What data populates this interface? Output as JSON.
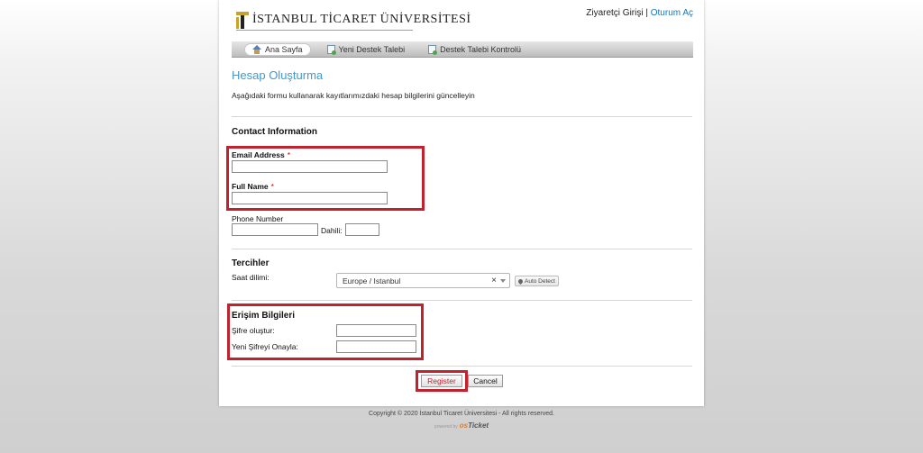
{
  "header": {
    "logo_text": "İSTANBUL TİCARET ÜNİVERSİTESİ",
    "guest_login": "Ziyaretçi Girişi",
    "separator": "|",
    "sign_in": "Oturum Aç"
  },
  "nav": {
    "items": [
      {
        "label": "Ana Sayfa",
        "icon": "home-icon",
        "active": true
      },
      {
        "label": "Yeni Destek Talebi",
        "icon": "new-ticket-icon",
        "active": false
      },
      {
        "label": "Destek Talebi Kontrolü",
        "icon": "ticket-status-icon",
        "active": false
      }
    ]
  },
  "page": {
    "title": "Hesap Oluşturma",
    "intro": "Aşağıdaki formu kullanarak kayıtlarımızdaki hesap bilgilerini güncelleyin"
  },
  "contact": {
    "title": "Contact Information",
    "email_label": "Email Address",
    "email_value": "",
    "full_name_label": "Full Name",
    "full_name_value": "",
    "required_mark": "*",
    "phone_label": "Phone Number",
    "phone_value": "",
    "ext_label": "Dahili:",
    "ext_value": ""
  },
  "preferences": {
    "title": "Tercihler",
    "timezone_label": "Saat dilimi:",
    "timezone_value": "Europe / Istanbul",
    "clear_glyph": "×",
    "auto_detect_label": "Auto Detect"
  },
  "access": {
    "title": "Erişim Bilgileri",
    "password_label": "Şifre oluştur:",
    "password_value": "",
    "confirm_label": "Yeni Şifreyi Onayla:",
    "confirm_value": ""
  },
  "actions": {
    "register_label": "Register",
    "cancel_label": "Cancel"
  },
  "footer": {
    "copyright": "Copyright © 2020 İstanbul Ticaret Üniversitesi - All rights reserved.",
    "powered_by": "powered by",
    "brand_os": "os",
    "brand_ticket": "Ticket"
  },
  "colors": {
    "accent": "#3a9bd5",
    "highlight": "#c0232e",
    "link": "#1b74b3",
    "logo_gold": "#c9a227"
  }
}
